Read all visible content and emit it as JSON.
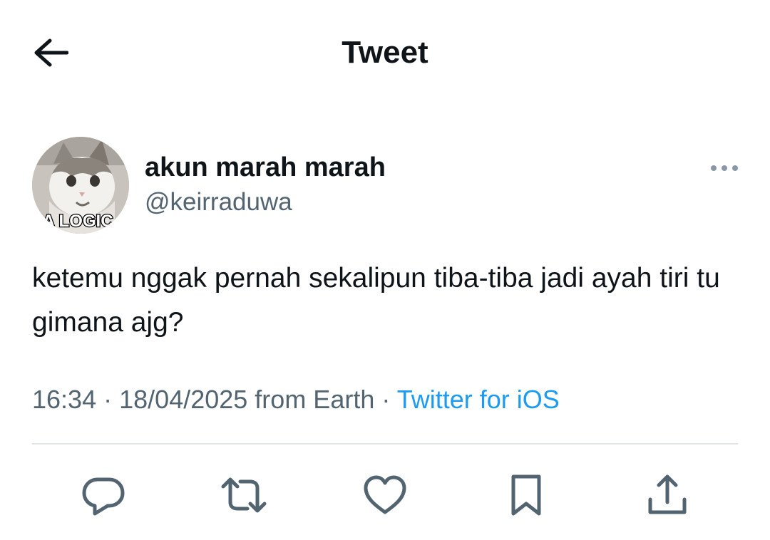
{
  "header": {
    "title": "Tweet",
    "back_icon": "arrow-left-icon"
  },
  "tweet": {
    "author": {
      "name": "akun marah marah",
      "handle": "@keirraduwa",
      "avatar_caption": "A LOGIC"
    },
    "more_icon": "more-horizontal-icon",
    "text": "ketemu nggak pernah sekalipun tiba-tiba jadi ayah tiri tu gimana ajg?",
    "meta": {
      "time": "16:34",
      "separator": "·",
      "date_location": "18/04/2025 from Earth",
      "source": "Twitter for iOS"
    },
    "actions": [
      {
        "name": "reply",
        "icon": "reply-icon"
      },
      {
        "name": "retweet",
        "icon": "retweet-icon"
      },
      {
        "name": "like",
        "icon": "heart-icon"
      },
      {
        "name": "bookmark",
        "icon": "bookmark-icon"
      },
      {
        "name": "share",
        "icon": "share-icon"
      }
    ]
  },
  "colors": {
    "text_primary": "#0f1419",
    "text_secondary": "#536471",
    "link": "#1d9bf0",
    "divider": "#e1e5e8",
    "icon": "#536471"
  }
}
